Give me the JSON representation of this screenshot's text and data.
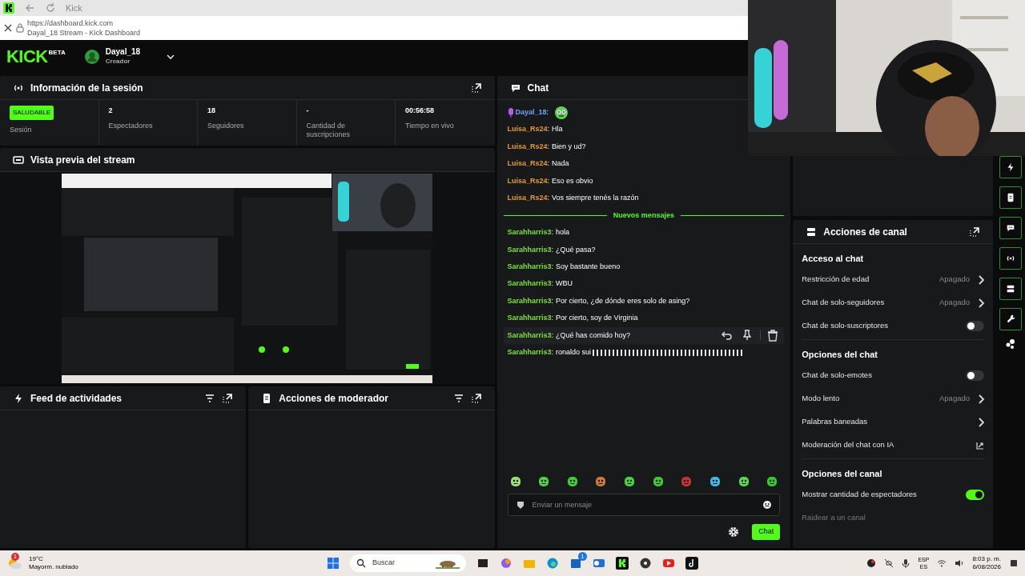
{
  "browser": {
    "tab_title": "Kick",
    "url": "https://dashboard.kick.com",
    "page_title": "Dayal_18 Stream - Kick Dashboard"
  },
  "header": {
    "logo": "KICK",
    "logo_badge": "BETA",
    "user": "Dayal_18",
    "role": "Creador"
  },
  "session": {
    "title": "Información de la sesión",
    "status": "SALUDABLE",
    "status_label": "Sesión",
    "stats": [
      {
        "value": "2",
        "label": "Espectadores"
      },
      {
        "value": "18",
        "label": "Seguidores"
      },
      {
        "value": "-",
        "label": "Cantidad de suscripciones"
      },
      {
        "value": "00:56:58",
        "label": "Tiempo en vivo"
      }
    ]
  },
  "preview": {
    "title": "Vista previa del stream"
  },
  "panels": [
    {
      "title": "Feed de actividades",
      "kind": "feed"
    },
    {
      "title": "Acciones de moderador",
      "kind": "mod"
    }
  ],
  "chat": {
    "title": "Chat",
    "messages": [
      {
        "user": "Dayal_18",
        "kind": "emote",
        "color": "#6fa3ff",
        "highlighted": false
      },
      {
        "user": "Luisa_Rs24",
        "text": "Hla",
        "kind": "text",
        "color": "#e59a2b",
        "highlighted": false
      },
      {
        "user": "Luisa_Rs24",
        "text": "Bien y ud?",
        "kind": "text",
        "color": "#e59a2b",
        "highlighted": false
      },
      {
        "user": "Luisa_Rs24",
        "text": "Nada",
        "kind": "text",
        "color": "#e59a2b",
        "highlighted": false
      },
      {
        "user": "Luisa_Rs24",
        "text": "Eso es obvio",
        "kind": "text",
        "color": "#e59a2b",
        "highlighted": false
      },
      {
        "user": "Luisa_Rs24",
        "text": "Vos siempre tenés la razón",
        "kind": "text",
        "color": "#e59a2b",
        "highlighted": false
      },
      {
        "kind": "divider",
        "text": "Nuevos mensajes"
      },
      {
        "user": "Sarahharris3",
        "text": "hola",
        "kind": "text",
        "color": "#7ee02e",
        "highlighted": false
      },
      {
        "user": "Sarahharris3",
        "text": "¿Qué pasa?",
        "kind": "text",
        "color": "#7ee02e",
        "highlighted": false
      },
      {
        "user": "Sarahharris3",
        "text": "Soy bastante bueno",
        "kind": "text",
        "color": "#7ee02e",
        "highlighted": false
      },
      {
        "user": "Sarahharris3",
        "text": "WBU",
        "kind": "text",
        "color": "#7ee02e",
        "highlighted": false
      },
      {
        "user": "Sarahharris3",
        "text": "Por cierto, ¿de dónde eres solo de asing?",
        "kind": "text",
        "color": "#7ee02e",
        "highlighted": false
      },
      {
        "user": "Sarahharris3",
        "text": "Por cierto, soy de Virginia",
        "kind": "text",
        "color": "#7ee02e",
        "highlighted": false
      },
      {
        "user": "Sarahharris3",
        "text": "¿Qué has comido hoy?",
        "kind": "text",
        "color": "#7ee02e",
        "highlighted": true
      },
      {
        "user": "Sarahharris3",
        "text": "ronaldo sui",
        "kind": "garbled",
        "color": "#7ee02e",
        "highlighted": false
      }
    ],
    "emotes": [
      {
        "color": "#9be07a"
      },
      {
        "color": "#4fd14a"
      },
      {
        "color": "#3ccf3a"
      },
      {
        "color": "#c9793a"
      },
      {
        "color": "#47d43f"
      },
      {
        "color": "#3fc93a"
      },
      {
        "color": "#c83434"
      },
      {
        "color": "#3fb9e6"
      },
      {
        "color": "#5bd84a"
      },
      {
        "color": "#36c92f"
      }
    ],
    "separator": ":",
    "placeholder": "Enviar un mensaje",
    "send": "Chat"
  },
  "channel_actions": {
    "title": "Acciones de canal",
    "sections": [
      {
        "title": "Acceso al chat",
        "items": [
          {
            "label": "Restricción de edad",
            "kind": "value",
            "value": "Apagado"
          },
          {
            "label": "Chat de solo-seguidores",
            "kind": "value",
            "value": "Apagado"
          },
          {
            "label": "Chat de solo-suscriptores",
            "kind": "toggle",
            "on": false
          }
        ]
      },
      {
        "title": "Opciones del chat",
        "items": [
          {
            "label": "Chat de solo-emotes",
            "kind": "toggle",
            "on": false
          },
          {
            "label": "Modo lento",
            "kind": "value",
            "value": "Apagado"
          },
          {
            "label": "Palabras baneadas",
            "kind": "chevron"
          },
          {
            "label": "Moderación del chat con IA",
            "kind": "external"
          }
        ]
      },
      {
        "title": "Opciones del canal",
        "items": [
          {
            "label": "Mostrar cantidad de espectadores",
            "kind": "toggle",
            "on": true
          },
          {
            "label": "Raidear a un canal",
            "kind": "disabled"
          }
        ]
      }
    ]
  },
  "taskbar": {
    "temperature": "19°C",
    "weather": "Mayorm. nublado",
    "weather_badge": "1",
    "search": "Buscar",
    "store_badge": "1",
    "lang": "ESP",
    "lang_sub": "ES",
    "time": "8:03 p. m.",
    "date": "6/08/2026"
  }
}
